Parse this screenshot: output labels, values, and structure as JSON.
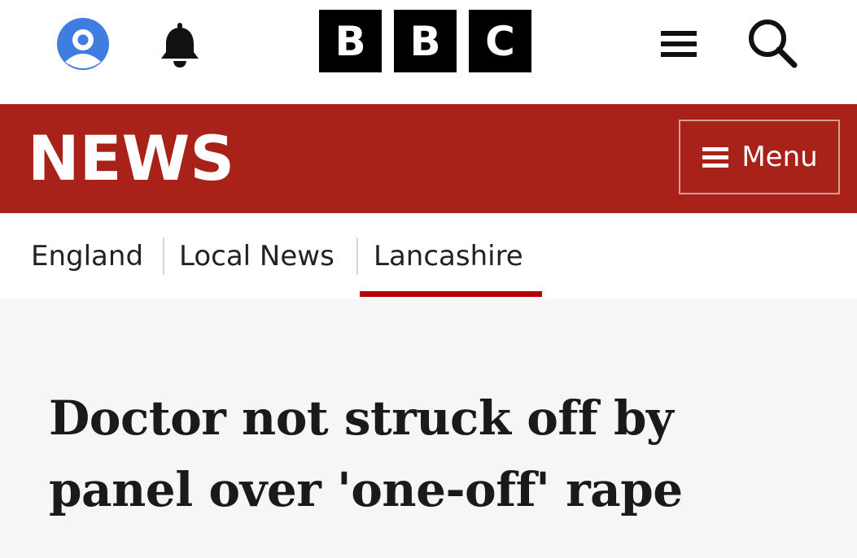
{
  "header": {
    "logo_letters": [
      "B",
      "B",
      "C"
    ],
    "icons": {
      "account": "account-icon",
      "notifications": "bell-icon",
      "more": "hamburger-icon",
      "search": "search-icon"
    }
  },
  "newsbar": {
    "title": "NEWS",
    "menu_label": "Menu",
    "background_color": "#a8221a"
  },
  "breadcrumb": {
    "items": [
      {
        "label": "England"
      },
      {
        "label": "Local News"
      },
      {
        "label": "Lancashire",
        "active": true
      }
    ],
    "active_underline_color": "#b80000"
  },
  "article": {
    "headline": "Doctor not struck off by panel over 'one-off' rape"
  }
}
